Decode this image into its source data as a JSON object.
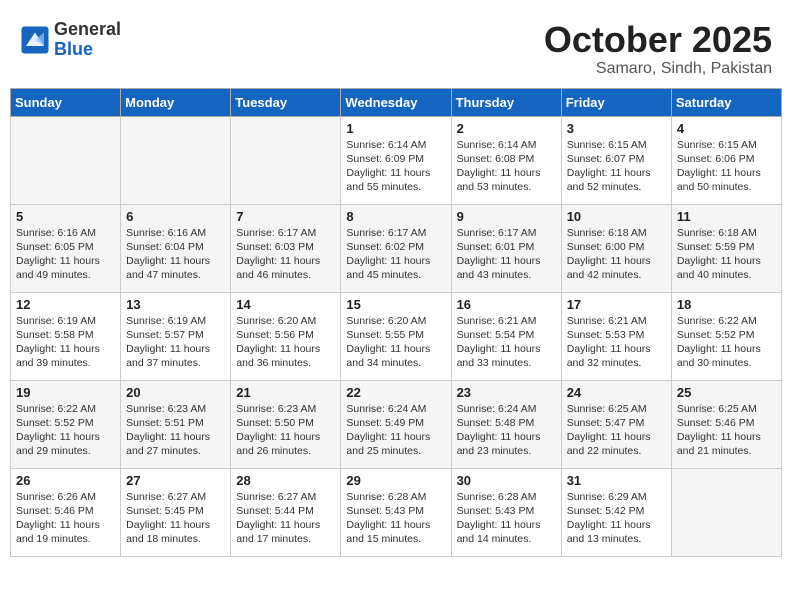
{
  "header": {
    "logo_general": "General",
    "logo_blue": "Blue",
    "month_title": "October 2025",
    "location": "Samaro, Sindh, Pakistan"
  },
  "weekdays": [
    "Sunday",
    "Monday",
    "Tuesday",
    "Wednesday",
    "Thursday",
    "Friday",
    "Saturday"
  ],
  "weeks": [
    [
      {
        "day": "",
        "info": ""
      },
      {
        "day": "",
        "info": ""
      },
      {
        "day": "",
        "info": ""
      },
      {
        "day": "1",
        "info": "Sunrise: 6:14 AM\nSunset: 6:09 PM\nDaylight: 11 hours\nand 55 minutes."
      },
      {
        "day": "2",
        "info": "Sunrise: 6:14 AM\nSunset: 6:08 PM\nDaylight: 11 hours\nand 53 minutes."
      },
      {
        "day": "3",
        "info": "Sunrise: 6:15 AM\nSunset: 6:07 PM\nDaylight: 11 hours\nand 52 minutes."
      },
      {
        "day": "4",
        "info": "Sunrise: 6:15 AM\nSunset: 6:06 PM\nDaylight: 11 hours\nand 50 minutes."
      }
    ],
    [
      {
        "day": "5",
        "info": "Sunrise: 6:16 AM\nSunset: 6:05 PM\nDaylight: 11 hours\nand 49 minutes."
      },
      {
        "day": "6",
        "info": "Sunrise: 6:16 AM\nSunset: 6:04 PM\nDaylight: 11 hours\nand 47 minutes."
      },
      {
        "day": "7",
        "info": "Sunrise: 6:17 AM\nSunset: 6:03 PM\nDaylight: 11 hours\nand 46 minutes."
      },
      {
        "day": "8",
        "info": "Sunrise: 6:17 AM\nSunset: 6:02 PM\nDaylight: 11 hours\nand 45 minutes."
      },
      {
        "day": "9",
        "info": "Sunrise: 6:17 AM\nSunset: 6:01 PM\nDaylight: 11 hours\nand 43 minutes."
      },
      {
        "day": "10",
        "info": "Sunrise: 6:18 AM\nSunset: 6:00 PM\nDaylight: 11 hours\nand 42 minutes."
      },
      {
        "day": "11",
        "info": "Sunrise: 6:18 AM\nSunset: 5:59 PM\nDaylight: 11 hours\nand 40 minutes."
      }
    ],
    [
      {
        "day": "12",
        "info": "Sunrise: 6:19 AM\nSunset: 5:58 PM\nDaylight: 11 hours\nand 39 minutes."
      },
      {
        "day": "13",
        "info": "Sunrise: 6:19 AM\nSunset: 5:57 PM\nDaylight: 11 hours\nand 37 minutes."
      },
      {
        "day": "14",
        "info": "Sunrise: 6:20 AM\nSunset: 5:56 PM\nDaylight: 11 hours\nand 36 minutes."
      },
      {
        "day": "15",
        "info": "Sunrise: 6:20 AM\nSunset: 5:55 PM\nDaylight: 11 hours\nand 34 minutes."
      },
      {
        "day": "16",
        "info": "Sunrise: 6:21 AM\nSunset: 5:54 PM\nDaylight: 11 hours\nand 33 minutes."
      },
      {
        "day": "17",
        "info": "Sunrise: 6:21 AM\nSunset: 5:53 PM\nDaylight: 11 hours\nand 32 minutes."
      },
      {
        "day": "18",
        "info": "Sunrise: 6:22 AM\nSunset: 5:52 PM\nDaylight: 11 hours\nand 30 minutes."
      }
    ],
    [
      {
        "day": "19",
        "info": "Sunrise: 6:22 AM\nSunset: 5:52 PM\nDaylight: 11 hours\nand 29 minutes."
      },
      {
        "day": "20",
        "info": "Sunrise: 6:23 AM\nSunset: 5:51 PM\nDaylight: 11 hours\nand 27 minutes."
      },
      {
        "day": "21",
        "info": "Sunrise: 6:23 AM\nSunset: 5:50 PM\nDaylight: 11 hours\nand 26 minutes."
      },
      {
        "day": "22",
        "info": "Sunrise: 6:24 AM\nSunset: 5:49 PM\nDaylight: 11 hours\nand 25 minutes."
      },
      {
        "day": "23",
        "info": "Sunrise: 6:24 AM\nSunset: 5:48 PM\nDaylight: 11 hours\nand 23 minutes."
      },
      {
        "day": "24",
        "info": "Sunrise: 6:25 AM\nSunset: 5:47 PM\nDaylight: 11 hours\nand 22 minutes."
      },
      {
        "day": "25",
        "info": "Sunrise: 6:25 AM\nSunset: 5:46 PM\nDaylight: 11 hours\nand 21 minutes."
      }
    ],
    [
      {
        "day": "26",
        "info": "Sunrise: 6:26 AM\nSunset: 5:46 PM\nDaylight: 11 hours\nand 19 minutes."
      },
      {
        "day": "27",
        "info": "Sunrise: 6:27 AM\nSunset: 5:45 PM\nDaylight: 11 hours\nand 18 minutes."
      },
      {
        "day": "28",
        "info": "Sunrise: 6:27 AM\nSunset: 5:44 PM\nDaylight: 11 hours\nand 17 minutes."
      },
      {
        "day": "29",
        "info": "Sunrise: 6:28 AM\nSunset: 5:43 PM\nDaylight: 11 hours\nand 15 minutes."
      },
      {
        "day": "30",
        "info": "Sunrise: 6:28 AM\nSunset: 5:43 PM\nDaylight: 11 hours\nand 14 minutes."
      },
      {
        "day": "31",
        "info": "Sunrise: 6:29 AM\nSunset: 5:42 PM\nDaylight: 11 hours\nand 13 minutes."
      },
      {
        "day": "",
        "info": ""
      }
    ]
  ]
}
